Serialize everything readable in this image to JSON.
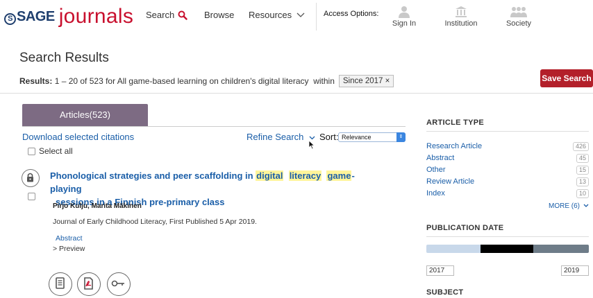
{
  "header": {
    "logo_sage": "SAGE",
    "logo_journals": "journals",
    "nav": {
      "search": "Search",
      "browse": "Browse",
      "resources": "Resources"
    },
    "access_label": "Access Options:",
    "access": [
      {
        "label": "Sign In",
        "icon": "person-icon"
      },
      {
        "label": "Institution",
        "icon": "institution-icon"
      },
      {
        "label": "Society",
        "icon": "society-icon"
      }
    ],
    "brand_color": "#c8102e"
  },
  "results": {
    "title": "Search Results",
    "prefix": "Results:",
    "summary": "1 – 20 of 523 for All game-based learning on children's digital literacy",
    "within_label": "within",
    "filter_chip": "Since 2017 ×",
    "save_button": "Save Search"
  },
  "tabs": [
    {
      "label": "Articles(523)",
      "active": true
    }
  ],
  "toolbar": {
    "download": "Download selected citations",
    "refine": "Refine Search",
    "sort_label": "Sort:",
    "sort_value": "Relevance",
    "select_all": "Select all"
  },
  "article": {
    "title_part1": "Phonological strategies and peer scaffolding in ",
    "hl1": "digital",
    "hl2": "literacy",
    "hl3": "game",
    "title_part2": "-playing",
    "title_line2": "sessions in a Finnish pre-primary class",
    "authors": "Pirjo Kulju, Marita Mäkinen",
    "journal": "Journal of Early Childhood Literacy, First Published 5 Apr 2019.",
    "abstract": "Abstract",
    "preview": "> Preview",
    "action_icons": [
      "full-text-icon",
      "pdf-icon",
      "key-icon"
    ]
  },
  "sidebar": {
    "article_type_heading": "ARTICLE TYPE",
    "types": [
      {
        "label": "Research Article",
        "count": "426"
      },
      {
        "label": "Abstract",
        "count": "45"
      },
      {
        "label": "Other",
        "count": "15"
      },
      {
        "label": "Review Article",
        "count": "13"
      },
      {
        "label": "Index",
        "count": "10"
      }
    ],
    "more": "MORE (6)",
    "pub_date_heading": "PUBLICATION DATE",
    "year_from": "2017",
    "year_to": "2019",
    "next_heading": "SUBJECT"
  }
}
